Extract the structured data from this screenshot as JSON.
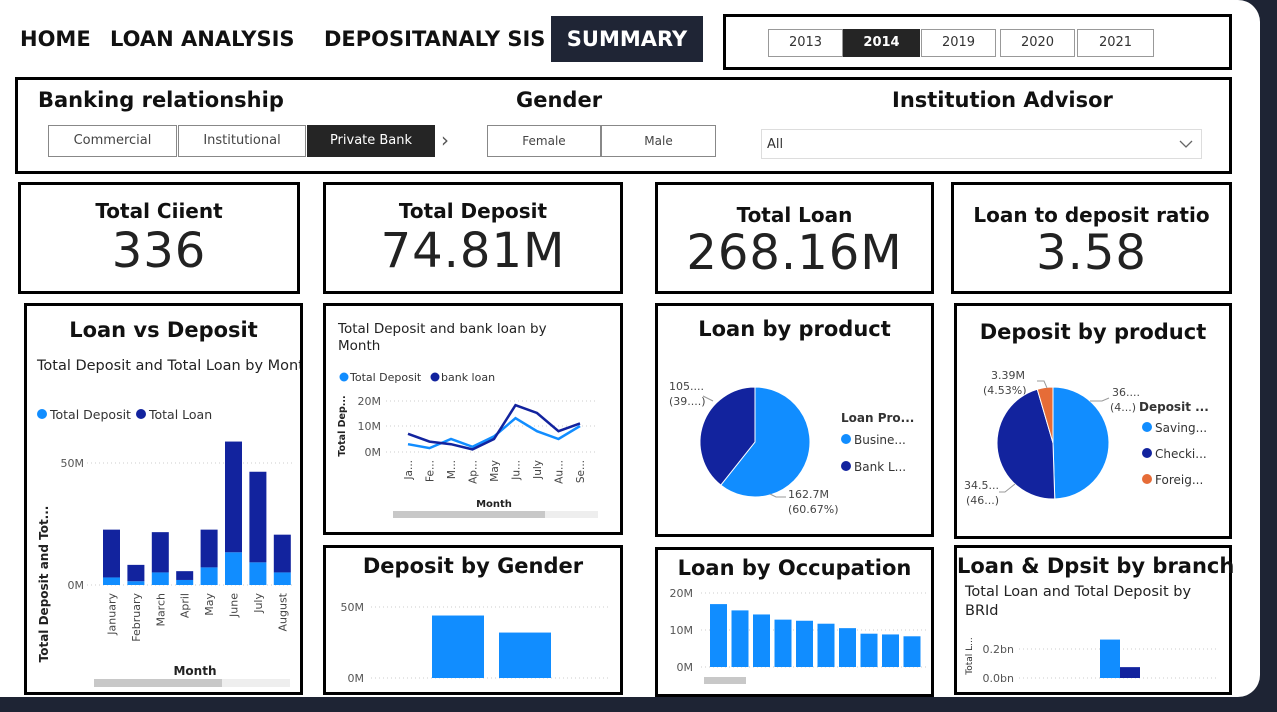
{
  "nav": {
    "home": "HOME",
    "loan": "LOAN ANALYSIS",
    "deposit": "DEPOSITANALY SIS",
    "summary": "SUMMARY"
  },
  "years": {
    "items": [
      "2013",
      "2014",
      "2019",
      "2020",
      "2021"
    ],
    "selected": "2014"
  },
  "slicers": {
    "banking_title": "Banking relationship",
    "banking_options": [
      "Commercial",
      "Institutional",
      "Private Bank"
    ],
    "banking_selected": "Private Bank",
    "gender_title": "Gender",
    "gender_options": [
      "Female",
      "Male"
    ],
    "advisor_title": "Institution Advisor",
    "advisor_value": "All"
  },
  "kpis": {
    "clients_label": "Total Ciient",
    "clients_value": "336",
    "deposit_label": "Total Deposit",
    "deposit_value": "74.81M",
    "loan_label": "Total Loan",
    "loan_value": "268.16M",
    "ratio_label": "Loan to deposit ratio",
    "ratio_value": "3.58"
  },
  "colors": {
    "deposit": "#118dff",
    "loan": "#12239e",
    "foreign": "#e66c37"
  },
  "chart_data": [
    {
      "type": "bar",
      "card_title": "Loan vs Deposit",
      "title": "Total Deposit and Total Loan by Month",
      "ylabel": "Total Deposit and Tot...",
      "xlabel": "Month",
      "legend": [
        "Total Deposit",
        "Total Loan"
      ],
      "yticks": [
        "50M",
        "0M"
      ],
      "categories": [
        "January",
        "February",
        "March",
        "April",
        "May",
        "June",
        "July",
        "August"
      ],
      "series": [
        {
          "name": "Total Deposit",
          "values": [
            3,
            1.5,
            5,
            2,
            7,
            13,
            9,
            5
          ]
        },
        {
          "name": "Total Loan",
          "values": [
            19,
            6.5,
            16,
            3.5,
            15,
            44,
            36,
            15
          ]
        }
      ],
      "stacked": true,
      "ylim": [
        0,
        60
      ]
    },
    {
      "type": "line",
      "title": "Total Deposit and bank loan by Month",
      "ylabel": "Total Dep...",
      "xlabel": "Month",
      "legend": [
        "Total Deposit",
        "bank loan"
      ],
      "yticks": [
        "20M",
        "10M",
        "0M"
      ],
      "categories": [
        "Ja...",
        "Fe...",
        "M...",
        "Ap...",
        "May",
        "Ju...",
        "July",
        "Au...",
        "Se..."
      ],
      "series": [
        {
          "name": "Total Deposit",
          "values": [
            3,
            1.5,
            5,
            2,
            6,
            13,
            8,
            5,
            10
          ]
        },
        {
          "name": "bank loan",
          "values": [
            7,
            4,
            3,
            1,
            5,
            18,
            15,
            8,
            11
          ]
        }
      ],
      "ylim": [
        0,
        22
      ]
    },
    {
      "type": "pie",
      "card_title": "Loan by product",
      "legend_title": "Loan Pro...",
      "legend": [
        "Busine...",
        "Bank L..."
      ],
      "labels": [
        {
          "value": "162.7M",
          "pct": "(60.67%)"
        },
        {
          "value": "105....",
          "pct": "(39....)"
        }
      ],
      "values": [
        60.67,
        39.33
      ]
    },
    {
      "type": "pie",
      "card_title": "Deposit by product",
      "legend_title": "Deposit ...",
      "legend": [
        "Saving...",
        "Checki...",
        "Foreig..."
      ],
      "labels": [
        {
          "value": "36....",
          "pct": "(4...)"
        },
        {
          "value": "34.5...",
          "pct": "(46...)"
        },
        {
          "value": "3.39M",
          "pct": "(4.53%)"
        }
      ],
      "values": [
        49.5,
        45.97,
        4.53
      ]
    },
    {
      "type": "bar",
      "card_title": "Deposit by Gender",
      "yticks": [
        "50M",
        "0M"
      ],
      "values": [
        44,
        32
      ],
      "ylim": [
        0,
        65
      ]
    },
    {
      "type": "bar",
      "card_title": "Loan by Occupation",
      "yticks": [
        "20M",
        "10M",
        "0M"
      ],
      "values": [
        17,
        15.3,
        14.2,
        12.8,
        12.5,
        11.7,
        10.5,
        9,
        8.8,
        8.3
      ],
      "ylim": [
        0,
        22
      ]
    },
    {
      "type": "bar",
      "card_title": "Loan & Dpsit by branch",
      "title": "Total Loan and Total Deposit by BRId",
      "ylabel": "Total L...",
      "yticks": [
        "0.2bn",
        "0.0bn"
      ],
      "series": [
        {
          "name": "Total Loan",
          "values": [
            0.265
          ]
        },
        {
          "name": "Total Deposit",
          "values": [
            0.075
          ]
        }
      ],
      "ylim": [
        0,
        0.36
      ]
    }
  ]
}
